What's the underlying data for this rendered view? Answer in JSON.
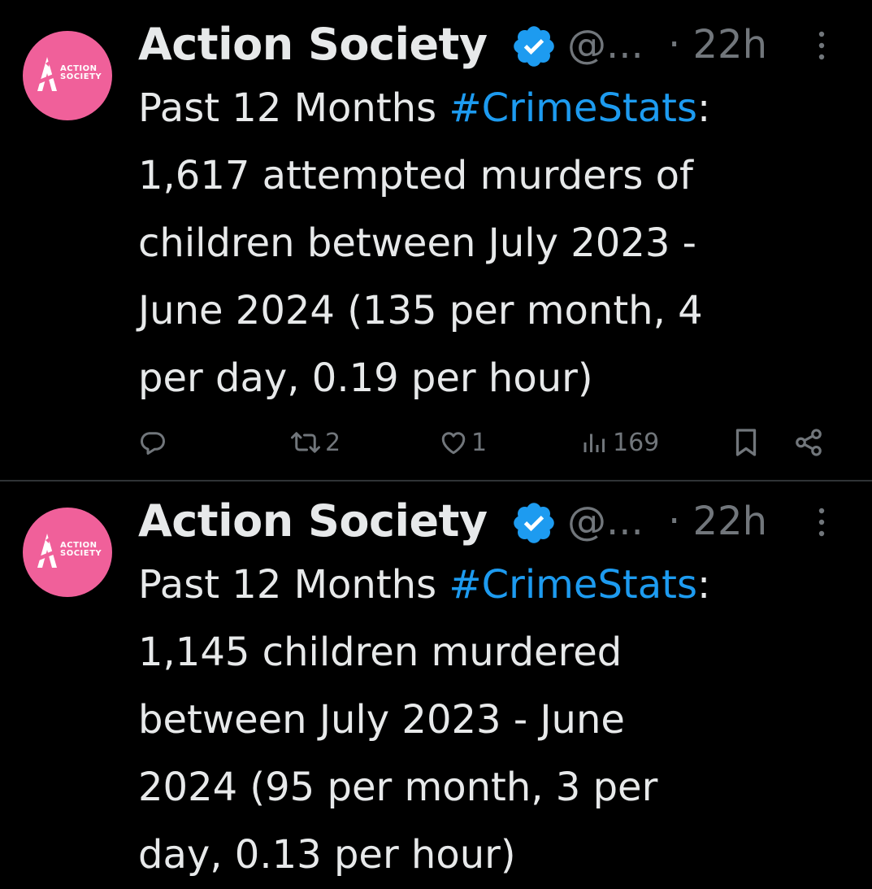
{
  "colors": {
    "background": "#000000",
    "text": "#e7e9ea",
    "muted": "#71767b",
    "link": "#1d9bf0",
    "avatar": "#f0609a",
    "verified": "#1d9bf0"
  },
  "tweets": [
    {
      "avatar_brand": [
        "ACTION",
        "SOCIETY"
      ],
      "author_name": "Action Society",
      "handle": "@...",
      "time": "· 22h",
      "text_prefix": "Past 12 Months ",
      "hashtag": "#CrimeStats",
      "text_suffix": ":",
      "lines": [
        "1,617 attempted murders of",
        "children between July 2023 -",
        "June 2024 (135 per month, 4",
        "per day, 0.19 per hour)"
      ],
      "actions": {
        "replies": "",
        "reposts": "2",
        "likes": "1",
        "views": "169"
      }
    },
    {
      "avatar_brand": [
        "ACTION",
        "SOCIETY"
      ],
      "author_name": "Action Society",
      "handle": "@...",
      "time": "· 22h",
      "text_prefix": "Past 12 Months ",
      "hashtag": "#CrimeStats",
      "text_suffix": ":",
      "lines": [
        "1,145 children murdered",
        "between July 2023 - June",
        "2024 (95 per month, 3 per",
        "day, 0.13 per hour)"
      ]
    }
  ]
}
